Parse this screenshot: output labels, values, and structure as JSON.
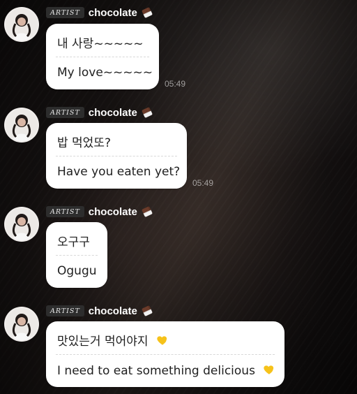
{
  "messages": [
    {
      "badge": "ARTIST",
      "name": "chocolate",
      "original": "내 사랑~~~~~",
      "translation": "My love~~~~~",
      "time": "05:49",
      "heart_icon": ""
    },
    {
      "badge": "ARTIST",
      "name": "chocolate",
      "original": "밥 먹었또?",
      "translation": "Have you eaten yet?",
      "time": "05:49",
      "heart_icon": ""
    },
    {
      "badge": "ARTIST",
      "name": "chocolate",
      "original": "오구구",
      "translation": "Ogugu",
      "time": "",
      "heart_icon": ""
    },
    {
      "badge": "ARTIST",
      "name": "chocolate",
      "original": "맛있는거 먹어야지",
      "translation": "I need to eat something delicious",
      "time": "",
      "heart_icon": "yellow-heart-icon"
    }
  ],
  "colors": {
    "bubble_bg": "#ffffff",
    "text": "#1f1f1f",
    "badge_bg": "#2d2d2d",
    "heart": "#f6c21a"
  },
  "icons": {
    "name_icon": "chocolate-bar-icon",
    "avatar": "profile-avatar-icon"
  }
}
